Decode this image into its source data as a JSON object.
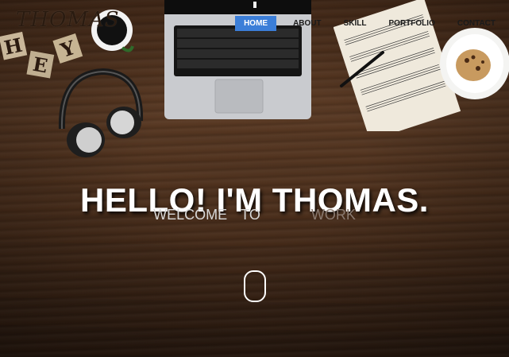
{
  "logo": {
    "text": "THOMAS"
  },
  "nav": {
    "items": [
      {
        "label": "HOME",
        "active": true
      },
      {
        "label": "ABOUT",
        "active": false
      },
      {
        "label": "SKILL",
        "active": false
      },
      {
        "label": "PORTFOLIO",
        "active": false
      },
      {
        "label": "CONTACT",
        "active": false
      }
    ]
  },
  "hero": {
    "title": "HELLO! I'M THOMAS.",
    "subtitle_words": [
      "WELCOME",
      "TO",
      "WORK"
    ]
  },
  "decor": {
    "blocks_letters": [
      "H",
      "E",
      "Y"
    ]
  },
  "icons": {
    "scroll": "mouse-scroll-icon"
  },
  "colors": {
    "nav_active_bg": "#3b7ed8",
    "title_text": "#ffffff"
  }
}
